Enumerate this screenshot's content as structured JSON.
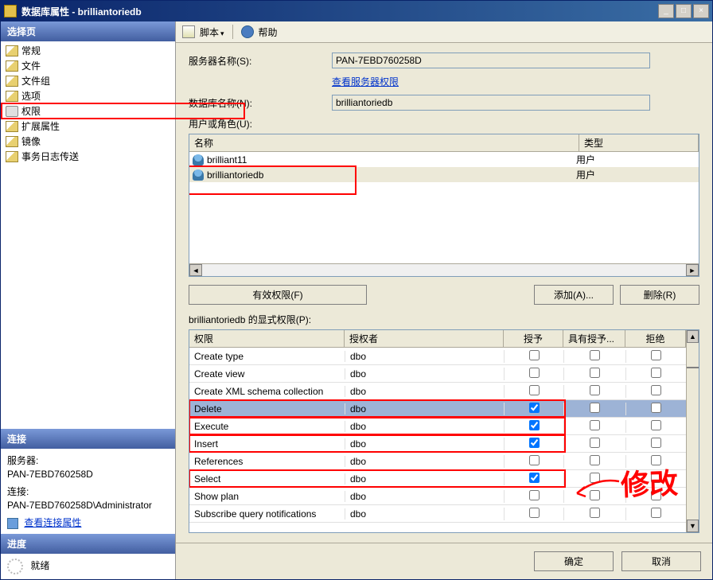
{
  "title": "数据库属性 - brilliantoriedb",
  "left": {
    "header_select": "选择页",
    "items": [
      "常规",
      "文件",
      "文件组",
      "选项",
      "权限",
      "扩展属性",
      "镜像",
      "事务日志传送"
    ],
    "header_conn": "连接",
    "server_lbl": "服务器:",
    "server_val": "PAN-7EBD760258D",
    "conn_lbl": "连接:",
    "conn_val": "PAN-7EBD760258D\\Administrator",
    "view_conn": "查看连接属性",
    "header_prog": "进度",
    "ready": "就绪"
  },
  "tb": {
    "script": "脚本",
    "help": "帮助"
  },
  "form": {
    "server_name_lbl": "服务器名称(S):",
    "server_name_val": "PAN-7EBD760258D",
    "view_perm": "查看服务器权限",
    "db_name_lbl": "数据库名称(N):",
    "db_name_val": "brilliantoriedb",
    "users_lbl": "用户或角色(U):",
    "col_name": "名称",
    "col_type": "类型",
    "users": [
      {
        "name": "brilliant11",
        "type": "用户"
      },
      {
        "name": "brilliantoriedb",
        "type": "用户"
      }
    ],
    "btn_eff": "有效权限(F)",
    "btn_add": "添加(A)...",
    "btn_del": "删除(R)",
    "explicit_lbl": "brilliantoriedb 的显式权限(P):",
    "pcol_perm": "权限",
    "pcol_grantor": "授权者",
    "pcol_grant": "授予",
    "pcol_wgrant": "具有授予...",
    "pcol_deny": "拒绝",
    "perms": [
      {
        "p": "Create type",
        "g": "dbo",
        "gr": false,
        "wg": false,
        "dn": false,
        "sel": false,
        "red": false
      },
      {
        "p": "Create view",
        "g": "dbo",
        "gr": false,
        "wg": false,
        "dn": false,
        "sel": false,
        "red": false
      },
      {
        "p": "Create XML schema collection",
        "g": "dbo",
        "gr": false,
        "wg": false,
        "dn": false,
        "sel": false,
        "red": false
      },
      {
        "p": "Delete",
        "g": "dbo",
        "gr": true,
        "wg": false,
        "dn": false,
        "sel": true,
        "red": true
      },
      {
        "p": "Execute",
        "g": "dbo",
        "gr": true,
        "wg": false,
        "dn": false,
        "sel": false,
        "red": true
      },
      {
        "p": "Insert",
        "g": "dbo",
        "gr": true,
        "wg": false,
        "dn": false,
        "sel": false,
        "red": true
      },
      {
        "p": "References",
        "g": "dbo",
        "gr": false,
        "wg": false,
        "dn": false,
        "sel": false,
        "red": false
      },
      {
        "p": "Select",
        "g": "dbo",
        "gr": true,
        "wg": false,
        "dn": false,
        "sel": false,
        "red": true
      },
      {
        "p": "Show plan",
        "g": "dbo",
        "gr": false,
        "wg": false,
        "dn": false,
        "sel": false,
        "red": false
      },
      {
        "p": "Subscribe query notifications",
        "g": "dbo",
        "gr": false,
        "wg": false,
        "dn": false,
        "sel": false,
        "red": false
      }
    ]
  },
  "bottom": {
    "ok": "确定",
    "cancel": "取消"
  },
  "annotation": "修改"
}
